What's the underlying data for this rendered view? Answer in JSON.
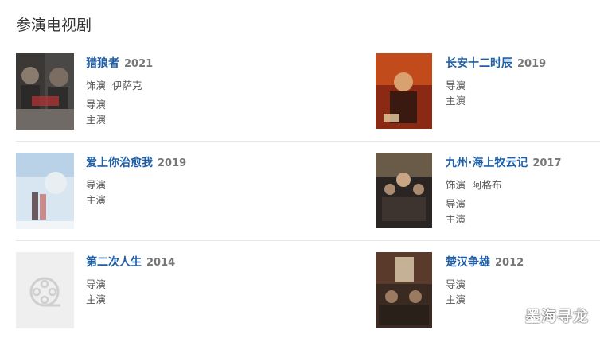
{
  "section": {
    "title": "参演电视剧"
  },
  "shows": [
    {
      "title": "猎狼者",
      "year": "2021",
      "role_label": "饰演",
      "role_name": "伊萨克",
      "director_label": "导演",
      "lead_label": "主演"
    },
    {
      "title": "长安十二时辰",
      "year": "2019",
      "director_label": "导演",
      "lead_label": "主演"
    },
    {
      "title": "爱上你治愈我",
      "year": "2019",
      "director_label": "导演",
      "lead_label": "主演"
    },
    {
      "title": "九州·海上牧云记",
      "year": "2017",
      "role_label": "饰演",
      "role_name": "阿格布",
      "director_label": "导演",
      "lead_label": "主演"
    },
    {
      "title": "第二次人生",
      "year": "2014",
      "director_label": "导演",
      "lead_label": "主演"
    },
    {
      "title": "楚汉争雄",
      "year": "2012",
      "director_label": "导演",
      "lead_label": "主演"
    }
  ],
  "watermark": "墨海寻龙",
  "colors": {
    "link": "#1f5fa8",
    "year": "#777777",
    "divider": "#e8e8e8"
  },
  "icons": [
    "film-reel-icon"
  ]
}
